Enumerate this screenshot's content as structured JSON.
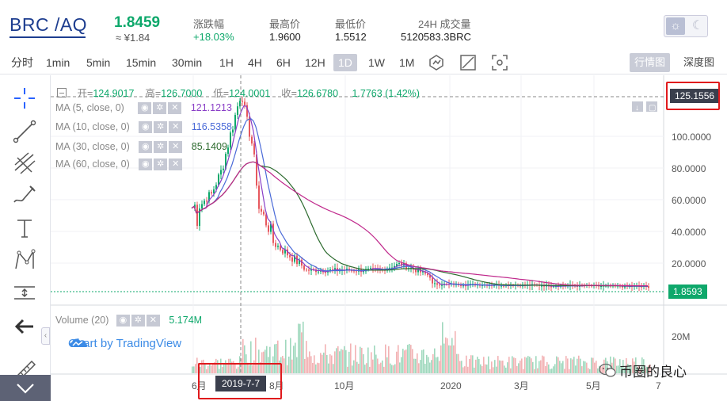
{
  "ticker": {
    "pair": "BRC /AQ",
    "price": "1.8459",
    "approx": "≈ ¥1.84",
    "change_label": "涨跌幅",
    "change_value": "+18.03%",
    "high_label": "最高价",
    "high_value": "1.9600",
    "low_label": "最低价",
    "low_value": "1.5512",
    "volume_label": "24H 成交量",
    "volume_value": "5120583.3BRC",
    "theme_day_icon": "sun-icon",
    "theme_night_icon": "moon-icon"
  },
  "toolbar": {
    "timeframes": [
      "分时",
      "1min",
      "5min",
      "15min",
      "30min",
      "1H",
      "4H",
      "6H",
      "12H",
      "1D",
      "1W",
      "1M"
    ],
    "active_timeframe": "1D",
    "icons": [
      "indicator-icon",
      "compare-icon",
      "fullscreen-icon"
    ],
    "views": [
      "行情图",
      "深度图"
    ],
    "active_view": "行情图"
  },
  "tools": [
    "crosshair-icon",
    "trend-line-icon",
    "pitchfork-icon",
    "brush-icon",
    "text-icon",
    "pattern-icon",
    "measure-icon",
    "back-arrow-icon",
    "ruler-icon"
  ],
  "legend": {
    "open_label": "开",
    "open": "124.9017",
    "high_label": "高",
    "high": "126.7000",
    "low_label": "低",
    "low": "124.0001",
    "close_label": "收",
    "close": "126.6780",
    "change": "1.7763 (1.42%)",
    "ma": [
      {
        "label": "MA (5, close, 0)",
        "value": "121.1213",
        "color": "#8a3fc7"
      },
      {
        "label": "MA (10, close, 0)",
        "value": "116.5358",
        "color": "#4a6ad8"
      },
      {
        "label": "MA (30, close, 0)",
        "value": "85.1409",
        "color": "#2d6b2f"
      },
      {
        "label": "MA (60, close, 0)",
        "value": "",
        "color": "#c0298c"
      }
    ],
    "volume_label": "Volume (20)",
    "volume_value": "5.174M",
    "brand": "Chart by TradingView"
  },
  "axis": {
    "price_ticks": [
      "100.0000",
      "80.0000",
      "60.0000",
      "40.0000",
      "20.0000"
    ],
    "volume_tick": "20M",
    "x_ticks": [
      "6月",
      "8月",
      "10月",
      "2020",
      "3月",
      "5月",
      "7"
    ],
    "crosshair_price": "125.1556",
    "last_price": "1.8593",
    "crosshair_date": "2019-7-7"
  },
  "colors": {
    "up": "#0ea86b",
    "down": "#e7585e",
    "highlight_box": "#e0191c",
    "tag_dark": "#3a3f4d"
  },
  "watermark": "币圈的良心"
}
